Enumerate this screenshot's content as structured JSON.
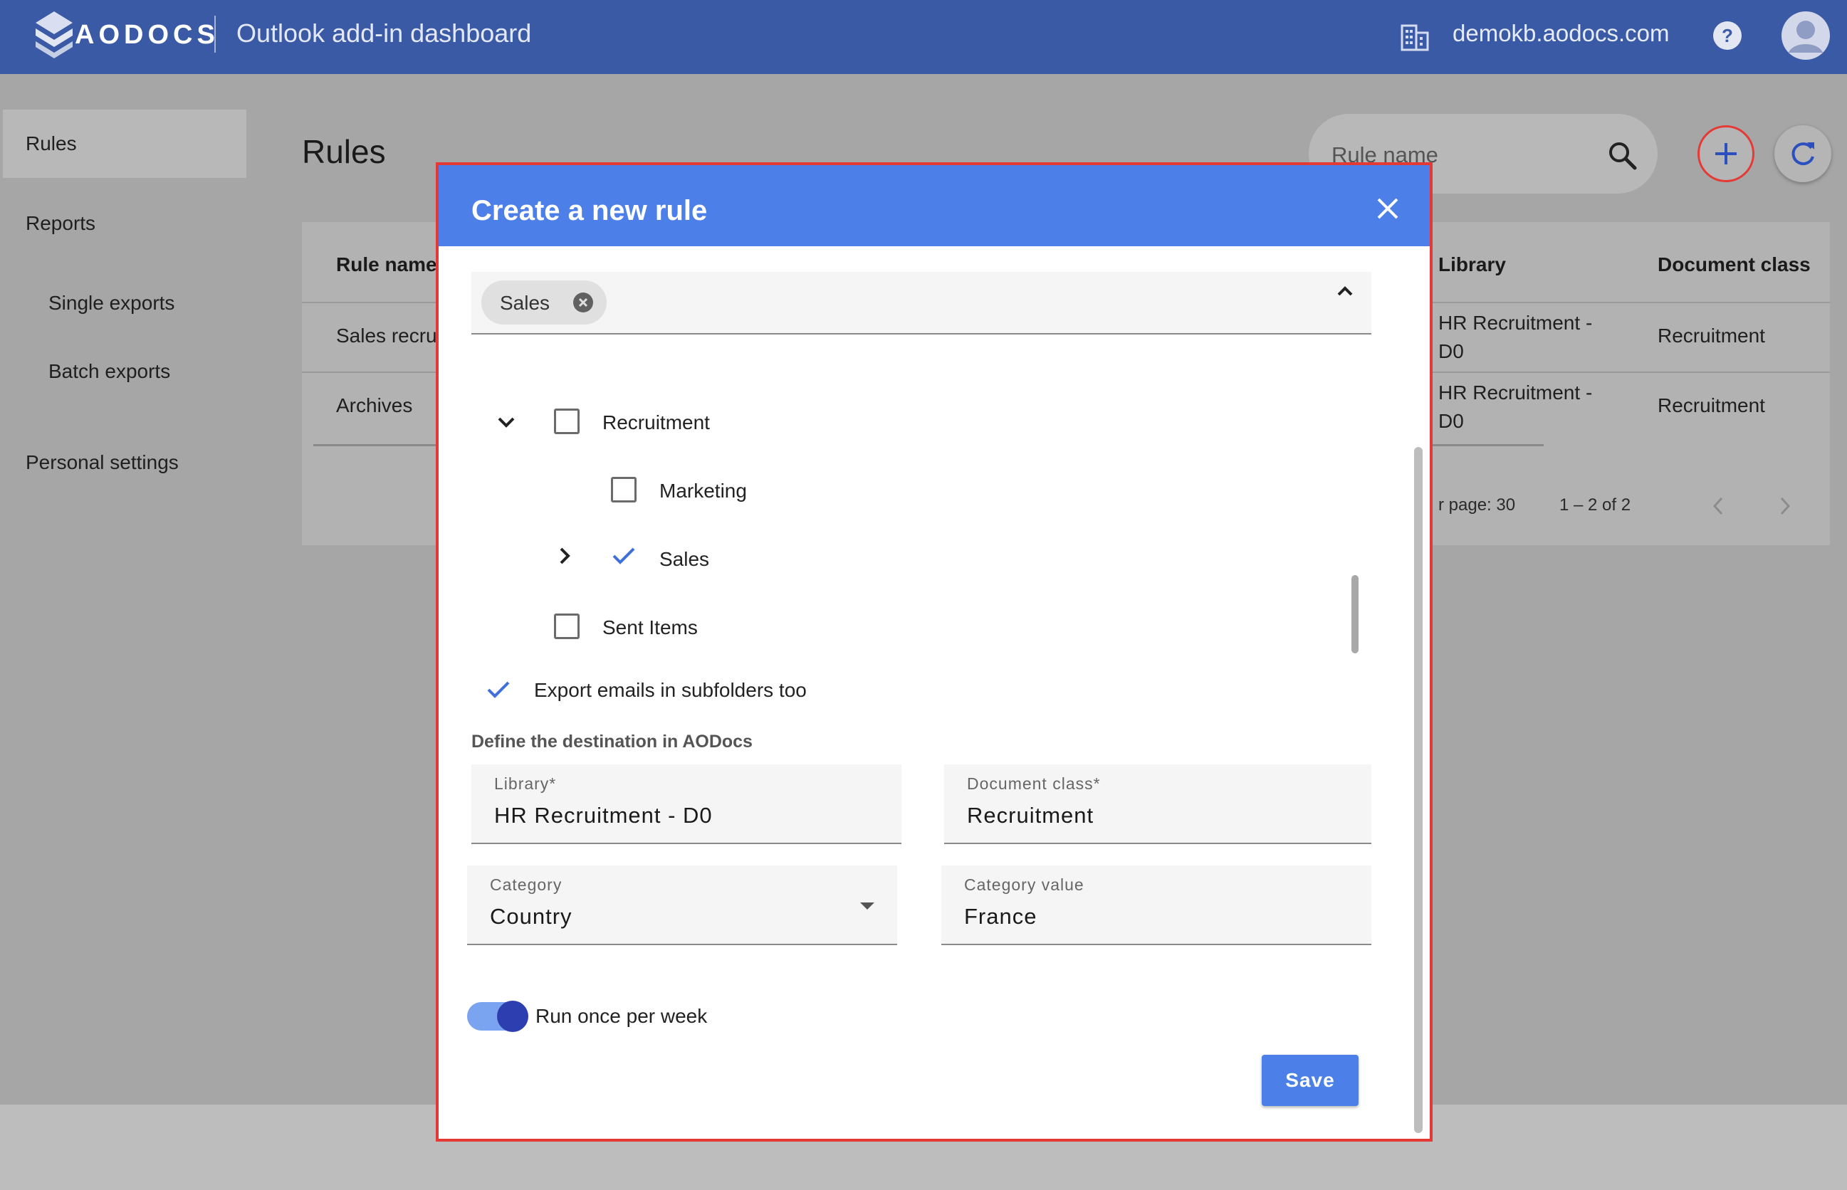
{
  "topbar": {
    "brand": "AODOCS",
    "app_title": "Outlook add-in dashboard",
    "domain": "demokb.aodocs.com",
    "icons": [
      "aodocs-logo",
      "building-icon",
      "help-icon",
      "account-avatar-icon"
    ]
  },
  "sidebar": {
    "items": [
      {
        "label": "Rules",
        "selected": true
      },
      {
        "label": "Reports"
      },
      {
        "label": "Single exports"
      },
      {
        "label": "Batch exports"
      },
      {
        "label": "Personal settings"
      }
    ]
  },
  "main": {
    "title": "Rules",
    "search_placeholder": "Rule name",
    "table": {
      "columns": [
        "Rule name",
        "Library",
        "Document class"
      ],
      "rows": [
        {
          "name": "Sales recru",
          "library_line1": "HR Recruitment -",
          "library_line2": "D0",
          "doc_class": "Recruitment"
        },
        {
          "name": "Archives",
          "library_line1": "HR Recruitment -",
          "library_line2": "D0",
          "doc_class": "Recruitment"
        }
      ]
    },
    "pager": {
      "per_page": "r page: 30",
      "range": "1 – 2 of 2"
    }
  },
  "dialog": {
    "title": "Create a new rule",
    "selected_chips": [
      "Sales"
    ],
    "folders": [
      {
        "label": "Recruitment",
        "checked": false,
        "expanded": true
      },
      {
        "label": "Marketing",
        "checked": false
      },
      {
        "label": "Sales",
        "checked": true,
        "expanded": false
      },
      {
        "label": "Sent Items",
        "checked": false
      }
    ],
    "subfolders_label": "Export emails in subfolders too",
    "subfolders_checked": true,
    "destination_label": "Define the destination in AODocs",
    "library": {
      "label": "Library*",
      "value": "HR Recruitment - D0"
    },
    "document_class": {
      "label": "Document class*",
      "value": "Recruitment"
    },
    "category": {
      "label": "Category",
      "value": "Country"
    },
    "category_value": {
      "label": "Category value",
      "value": "France"
    },
    "weekly_toggle": {
      "label": "Run once per week",
      "on": true
    },
    "save_label": "Save"
  },
  "colors": {
    "topbar": "#3a5aa6",
    "dialog_header": "#4c7fe8",
    "highlight_border": "#e53935",
    "toggle_knob": "#2d3fb0"
  }
}
